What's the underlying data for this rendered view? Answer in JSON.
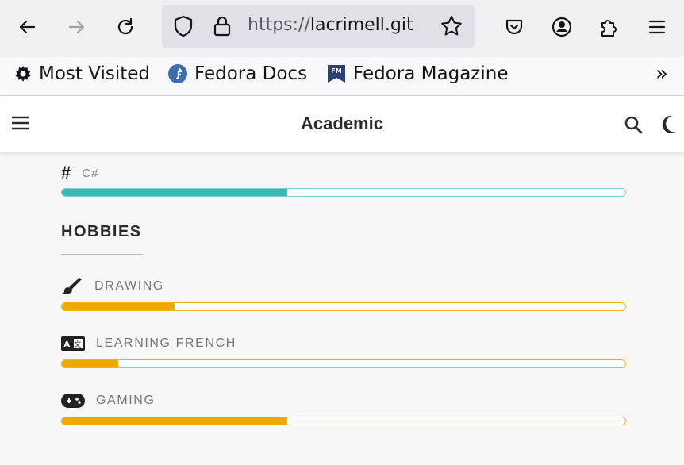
{
  "browser": {
    "url_prefix": "https://",
    "url_host": "lacrimell.git",
    "bookmarks": [
      {
        "label": "Most Visited"
      },
      {
        "label": "Fedora Docs"
      },
      {
        "label": "Fedora Magazine"
      }
    ],
    "overflow": "»"
  },
  "site": {
    "title": "Academic"
  },
  "skills": {
    "csharp": {
      "label": "C#",
      "progress": 0.4
    }
  },
  "hobbies": {
    "title": "HOBBIES",
    "items": [
      {
        "label": "DRAWING",
        "progress": 0.2
      },
      {
        "label": "LEARNING FRENCH",
        "progress": 0.1
      },
      {
        "label": "GAMING",
        "progress": 0.4
      }
    ]
  },
  "colors": {
    "teal": "#3bb8b5",
    "gold": "#efa800"
  }
}
